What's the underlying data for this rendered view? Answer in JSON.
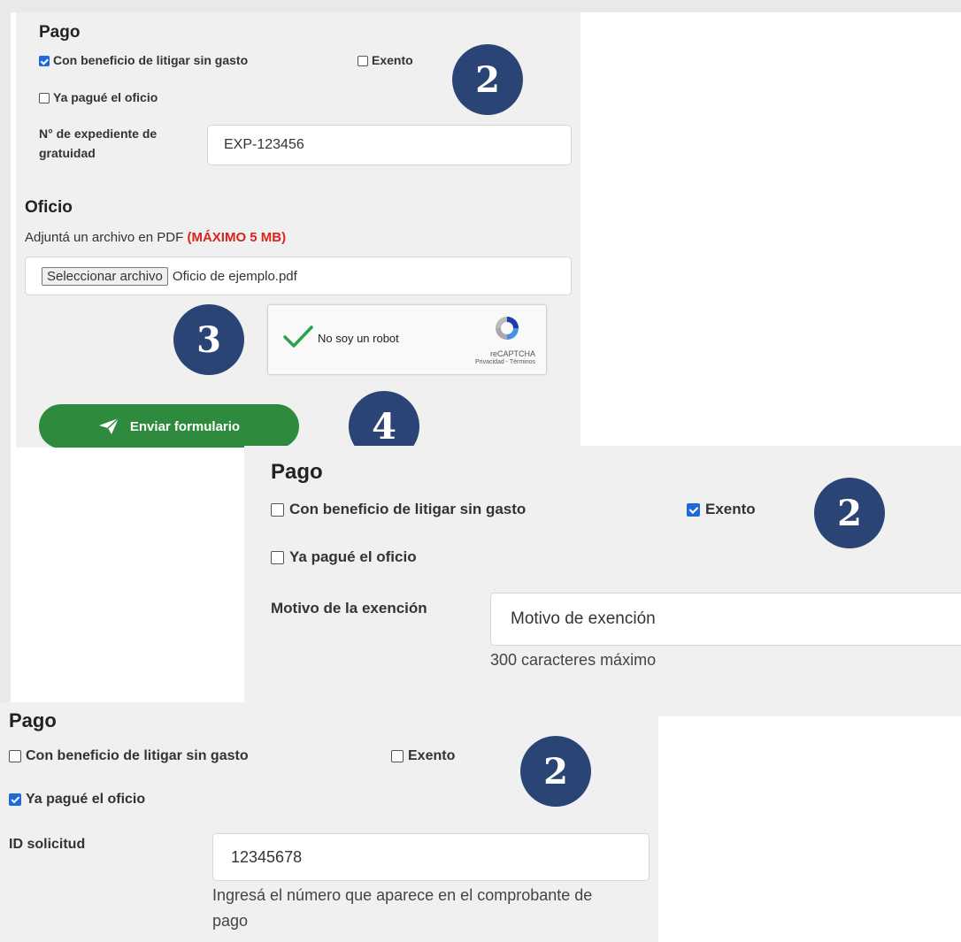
{
  "panel1": {
    "title": "Pago",
    "opt_litigar": "Con beneficio de litigar sin gasto",
    "opt_exento": "Exento",
    "opt_pague": "Ya pagué el oficio",
    "expediente_label_1": "N° de expediente de",
    "expediente_label_2": "gratuidad",
    "expediente_value": "EXP-123456",
    "oficio_title": "Oficio",
    "oficio_desc": "Adjuntá un archivo en PDF",
    "oficio_max": "(MÁXIMO 5 MB)",
    "file_button": "Seleccionar archivo",
    "file_name": "Oficio de ejemplo.pdf",
    "captcha_label": "No soy un robot",
    "captcha_brand": "reCAPTCHA",
    "captcha_links": "Privacidad - Términos",
    "submit_label": "Enviar formulario",
    "badge_2": "2",
    "badge_3": "3",
    "badge_4": "4",
    "checked": {
      "litigar": true,
      "exento": false,
      "pague": false
    }
  },
  "panel2": {
    "title": "Pago",
    "opt_litigar": "Con beneficio de litigar sin gasto",
    "opt_exento": "Exento",
    "opt_pague": "Ya pagué el oficio",
    "motivo_label": "Motivo de la exención",
    "motivo_value": "Motivo de exención",
    "motivo_help": "300 caracteres máximo",
    "badge": "2",
    "checked": {
      "litigar": false,
      "exento": true,
      "pague": false
    }
  },
  "panel3": {
    "title": "Pago",
    "opt_litigar": "Con beneficio de litigar sin gasto",
    "opt_exento": "Exento",
    "opt_pague": "Ya pagué el oficio",
    "id_label": "ID solicitud",
    "id_value": "12345678",
    "id_help_1": "Ingresá el número que aparece en el comprobante de",
    "id_help_2": "pago",
    "badge": "2",
    "checked": {
      "litigar": false,
      "exento": false,
      "pague": true
    }
  },
  "colors": {
    "panel_bg": "#f0f0f0",
    "badge_bg": "#2b4476",
    "submit_bg": "#2e8b3d",
    "max_red": "#d9231d",
    "checkbox_blue": "#1d6ad8"
  },
  "icons": {
    "submit": "paper-plane-icon",
    "captcha_check": "check-icon",
    "captcha_logo": "recaptcha-logo-icon"
  }
}
